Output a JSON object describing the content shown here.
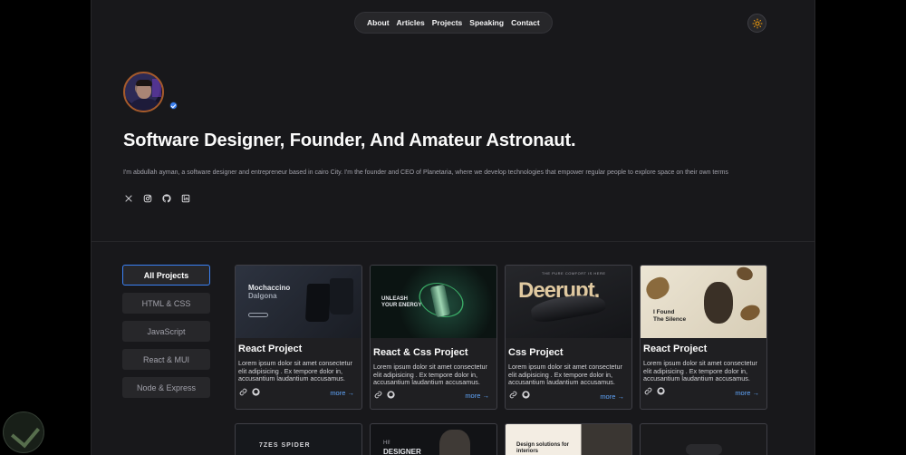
{
  "nav": {
    "items": [
      "About",
      "Articles",
      "Projects",
      "Speaking",
      "Contact"
    ]
  },
  "hero": {
    "headline": "Software Designer, Founder, And Amateur Astronaut.",
    "bio": "I'm abdullah ayman, a software designer and entrepreneur based in cairo City. I'm the founder and CEO of Planetaria, where we develop technologies that empower regular people to explore space on their own terms"
  },
  "socials": [
    "x-icon",
    "instagram-icon",
    "github-icon",
    "linkedin-icon"
  ],
  "filters": [
    {
      "label": "All Projects",
      "active": true
    },
    {
      "label": "HTML & CSS",
      "active": false
    },
    {
      "label": "JavaScript",
      "active": false
    },
    {
      "label": "React & MUI",
      "active": false
    },
    {
      "label": "Node & Express",
      "active": false
    }
  ],
  "cards": [
    {
      "title": "React Project",
      "thumb_text": [
        "Mochaccino",
        "Dalgona"
      ],
      "desc": "Lorem ipsum dolor sit amet consectetur elit adipisicing . Ex tempore dolor in, accusantium laudantium accusamus.",
      "more": "more"
    },
    {
      "title": "React & Css Project",
      "thumb_text": [
        "UNLEASH",
        "YOUR ENERGY"
      ],
      "desc": "Lorem ipsum dolor sit amet consectetur elit adipisicing . Ex tempore dolor in, accusantium laudantium accusamus.",
      "more": "more"
    },
    {
      "title": "Css Project",
      "thumb_text": [
        "THE PURE COMFORT IS HERE",
        "Deerupt."
      ],
      "desc": "Lorem ipsum dolor sit amet consectetur elit adipisicing . Ex tempore dolor in, accusantium laudantium accusamus.",
      "more": "more"
    },
    {
      "title": "React Project",
      "thumb_text": [
        "I Found",
        "The Silence"
      ],
      "desc": "Lorem ipsum dolor sit amet consectetur elit adipisicing . Ex tempore dolor in, accusantium laudantium accusamus.",
      "more": "more"
    }
  ],
  "row2": [
    "7ZES SPIDER",
    "HI!",
    "DESIGNER",
    "Design solutions for interiors",
    ""
  ],
  "colors": {
    "accent": "#3b82f6",
    "link": "#60a5fa",
    "surface": "#18181b"
  }
}
